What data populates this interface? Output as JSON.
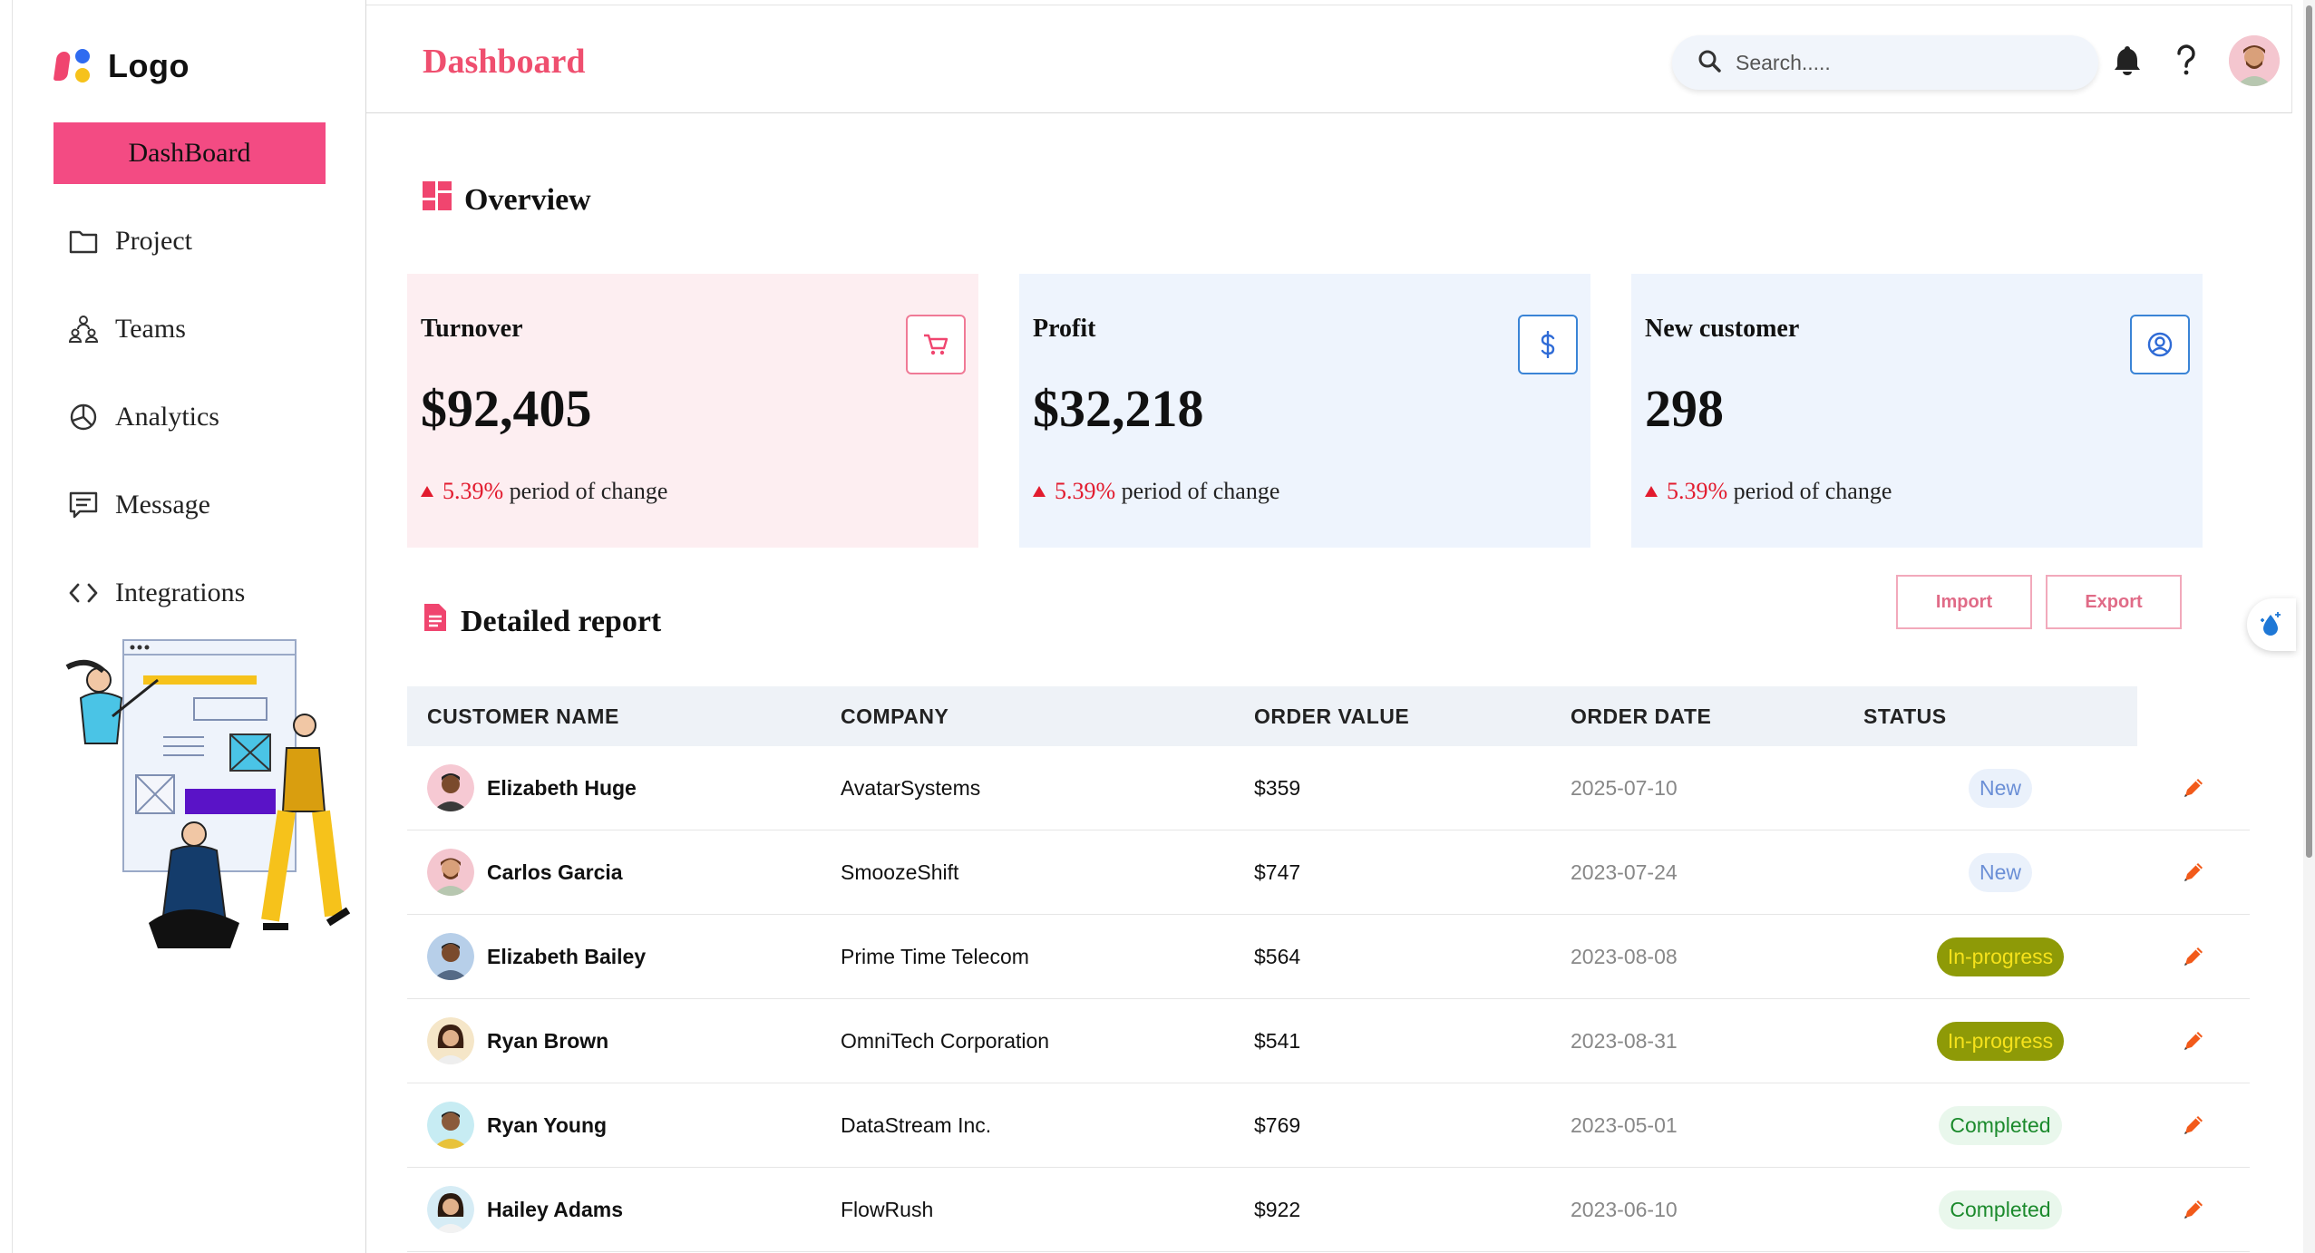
{
  "sidebar": {
    "logo_text": "Logo",
    "items": [
      {
        "label": "DashBoard",
        "icon": "dashboard-icon"
      },
      {
        "label": "Project",
        "icon": "folder-icon"
      },
      {
        "label": "Teams",
        "icon": "teams-icon"
      },
      {
        "label": "Analytics",
        "icon": "pie-chart-icon"
      },
      {
        "label": "Message",
        "icon": "message-icon"
      },
      {
        "label": "Integrations",
        "icon": "code-icon"
      }
    ]
  },
  "header": {
    "title": "Dashboard",
    "search_placeholder": "Search.....",
    "icons": [
      "search-icon",
      "bell-icon",
      "help-icon",
      "avatar"
    ]
  },
  "overview": {
    "title": "Overview",
    "cards": [
      {
        "label": "Turnover",
        "value": "$92,405",
        "pct": "5.39%",
        "change_text": "period of change",
        "icon": "cart-icon"
      },
      {
        "label": "Profit",
        "value": "$32,218",
        "pct": "5.39%",
        "change_text": "period of change",
        "icon": "dollar-icon"
      },
      {
        "label": "New customer",
        "value": "298",
        "pct": "5.39%",
        "change_text": "period of change",
        "icon": "user-circle-icon"
      }
    ]
  },
  "report": {
    "title": "Detailed report",
    "import_label": "Import",
    "export_label": "Export",
    "columns": [
      "CUSTOMER NAME",
      "COMPANY",
      "ORDER VALUE",
      "ORDER DATE",
      "STATUS"
    ],
    "rows": [
      {
        "name": "Elizabeth Huge",
        "company": "AvatarSystems",
        "value": "$359",
        "date": "2025-07-10",
        "status": "New"
      },
      {
        "name": "Carlos Garcia",
        "company": "SmoozeShift",
        "value": "$747",
        "date": "2023-07-24",
        "status": "New"
      },
      {
        "name": "Elizabeth Bailey",
        "company": "Prime Time Telecom",
        "value": "$564",
        "date": "2023-08-08",
        "status": "In-progress"
      },
      {
        "name": "Ryan Brown",
        "company": "OmniTech Corporation",
        "value": "$541",
        "date": "2023-08-31",
        "status": "In-progress"
      },
      {
        "name": "Ryan Young",
        "company": "DataStream Inc.",
        "value": "$769",
        "date": "2023-05-01",
        "status": "Completed"
      },
      {
        "name": "Hailey Adams",
        "company": "FlowRush",
        "value": "$922",
        "date": "2023-06-10",
        "status": "Completed"
      }
    ]
  },
  "colors": {
    "accent_pink": "#f34b83",
    "title_red": "#ef4f6f",
    "change_red": "#e21b2e",
    "card_pink": "#fdeef1",
    "card_blue": "#eef4fd"
  }
}
